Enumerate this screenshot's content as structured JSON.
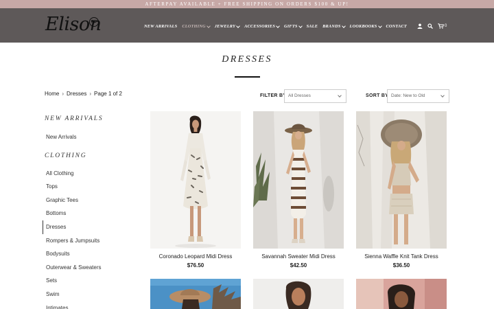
{
  "promo": {
    "text": "AFTERPAY AVAILABLE + FREE SHIPPING ON ORDERS $100 & UP!"
  },
  "header": {
    "logo_text": "Elison",
    "logo_badge": "RD",
    "cart_count": "0",
    "nav": [
      {
        "label": "NEW ARRIVALS",
        "has_dropdown": false
      },
      {
        "label": "CLOTHING",
        "has_dropdown": true
      },
      {
        "label": "JEWELRY",
        "has_dropdown": true
      },
      {
        "label": "ACCESSORIES",
        "has_dropdown": true
      },
      {
        "label": "GIFTS",
        "has_dropdown": true
      },
      {
        "label": "SALE",
        "has_dropdown": false
      },
      {
        "label": "BRANDS",
        "has_dropdown": true
      },
      {
        "label": "LOOKBOOKS",
        "has_dropdown": true
      },
      {
        "label": "CONTACT",
        "has_dropdown": false
      }
    ],
    "icons": [
      "user-icon",
      "search-icon",
      "cart-icon"
    ]
  },
  "page": {
    "title": "DRESSES"
  },
  "breadcrumb": {
    "home": "Home",
    "section": "Dresses",
    "page": "Page 1 of 2"
  },
  "sidebar": {
    "new_arrivals_heading": "NEW ARRIVALS",
    "new_arrivals_link": "New Arrivals",
    "clothing_heading": "CLOTHING",
    "clothing_links": [
      "All Clothing",
      "Tops",
      "Graphic Tees",
      "Bottoms",
      "Dresses",
      "Rompers & Jumpsuits",
      "Bodysuits",
      "Outerwear & Sweaters",
      "Sets",
      "Swim",
      "Intimates"
    ],
    "active_link": "Dresses"
  },
  "filters": {
    "filter_label": "FILTER BY:",
    "filter_value": "All Dresses",
    "sort_label": "SORT BY:",
    "sort_value": "Date: New to Old"
  },
  "products": [
    {
      "name": "Coronado Leopard Midi Dress",
      "price": "$76.50"
    },
    {
      "name": "Savannah Sweater Midi Dress",
      "price": "$42.50"
    },
    {
      "name": "Sienna Waffle Knit Tank Dress",
      "price": "$36.50"
    }
  ],
  "colors": {
    "promo_bar": "#c7a8a6",
    "header_bg": "#5e5959",
    "nav_text": "#ffffff",
    "nav_active": "#c6b8b6"
  }
}
